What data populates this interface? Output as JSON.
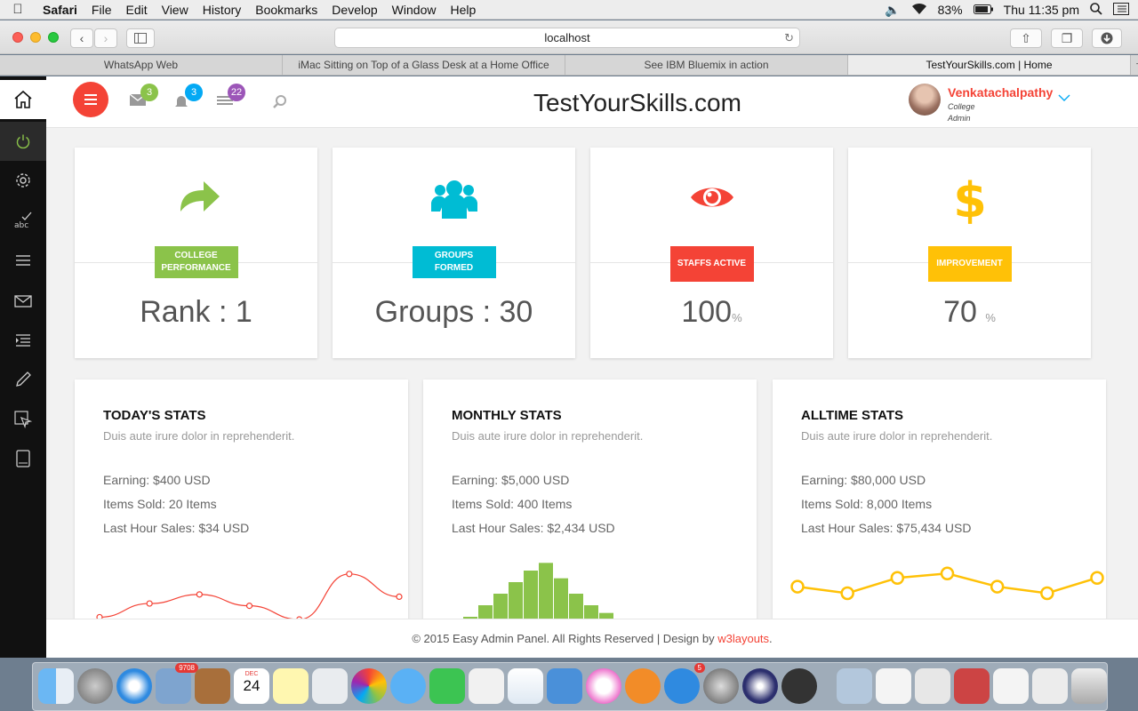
{
  "menubar": {
    "app": "Safari",
    "items": [
      "File",
      "Edit",
      "View",
      "History",
      "Bookmarks",
      "Develop",
      "Window",
      "Help"
    ],
    "battery": "83%",
    "clock": "Thu 11:35 pm"
  },
  "browser": {
    "url": "localhost",
    "tabs": [
      {
        "label": "WhatsApp Web"
      },
      {
        "label": "iMac Sitting on Top of a Glass Desk at a Home Office"
      },
      {
        "label": "See IBM Bluemix in action"
      },
      {
        "label": "TestYourSkills.com | Home"
      }
    ]
  },
  "header": {
    "brand": "TestYourSkills.com",
    "badges": {
      "mail": "3",
      "bell": "3",
      "list": "22"
    },
    "user_name": "Venkatachalpathy",
    "user_org": "College",
    "user_role": "Admin"
  },
  "cards": [
    {
      "label": "COLLEGE PERFORMANCE",
      "value": "Rank : 1",
      "unit": "",
      "color": "#8bc34a",
      "icon": "share-arrow-icon"
    },
    {
      "label": "GROUPS FORMED",
      "value": "Groups : 30",
      "unit": "",
      "color": "#00bcd4",
      "icon": "group-icon"
    },
    {
      "label": "STAFFS ACTIVE",
      "value": "100",
      "unit": "%",
      "color": "#f44336",
      "icon": "eye-icon"
    },
    {
      "label": "IMPROVEMENT",
      "value": "70",
      "unit": "%",
      "color": "#ffc107",
      "icon": "dollar-icon"
    }
  ],
  "stats": [
    {
      "title": "TODAY'S STATS",
      "subtitle": "Duis aute irure dolor in reprehenderit.",
      "earning": "Earning: $400 USD",
      "items": "Items Sold: 20 Items",
      "last": "Last Hour Sales: $34 USD"
    },
    {
      "title": "MONTHLY STATS",
      "subtitle": "Duis aute irure dolor in reprehenderit.",
      "earning": "Earning: $5,000 USD",
      "items": "Items Sold: 400 Items",
      "last": "Last Hour Sales: $2,434 USD"
    },
    {
      "title": "ALLTIME STATS",
      "subtitle": "Duis aute irure dolor in reprehenderit.",
      "earning": "Earning: $80,000 USD",
      "items": "Items Sold: 8,000 Items",
      "last": "Last Hour Sales: $75,434 USD"
    }
  ],
  "chart_data": [
    {
      "type": "line",
      "series": [
        {
          "values": [
            10,
            70,
            110,
            60,
            0,
            200,
            100
          ]
        }
      ],
      "ylim": [
        0,
        250
      ],
      "color": "#f44336"
    },
    {
      "type": "bar",
      "values": [
        20,
        30,
        60,
        90,
        120,
        150,
        170,
        130,
        90,
        60,
        40,
        20,
        5
      ],
      "ylim": [
        0,
        180
      ],
      "color": "#8bc34a"
    },
    {
      "type": "line",
      "series": [
        {
          "values": [
            150,
            120,
            190,
            210,
            150,
            120,
            190
          ]
        }
      ],
      "ylim": [
        0,
        260
      ],
      "color": "#ffc107"
    }
  ],
  "footer": {
    "text": "© 2015 Easy Admin Panel. All Rights Reserved | Design by ",
    "link": "w3layouts",
    "suffix": "."
  },
  "dock": {
    "mail_badge": "9708",
    "calendar_month": "DEC",
    "calendar_day": "24",
    "appstore_badge": "5"
  }
}
